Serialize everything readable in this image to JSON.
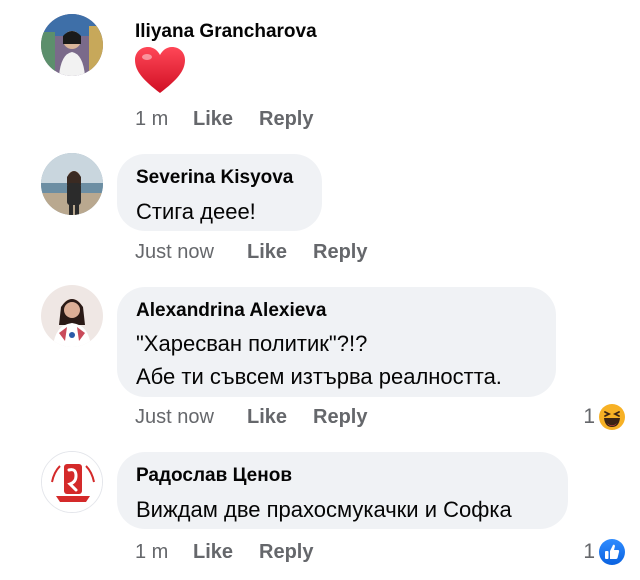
{
  "comments": [
    {
      "author": "Iliyana Grancharova",
      "text": "",
      "sticker": "heart-icon",
      "time": "1 m",
      "like_label": "Like",
      "reply_label": "Reply",
      "reaction": null
    },
    {
      "author": "Severina Kisyova",
      "text": "Стига деее!",
      "time": "Just now",
      "like_label": "Like",
      "reply_label": "Reply",
      "reaction": null
    },
    {
      "author": "Alexandrina Alexieva",
      "text": "\"Харесван политик\"?!?",
      "text_line2": "Абе ти съвсем изтърва реалността.",
      "time": "Just now",
      "like_label": "Like",
      "reply_label": "Reply",
      "reaction": {
        "count": "1",
        "icon": "laugh-haha-icon"
      }
    },
    {
      "author": "Радослав Ценов",
      "text": "Виждам две прахосмукачки и Софка",
      "time": "1 m",
      "like_label": "Like",
      "reply_label": "Reply",
      "reaction": {
        "count": "1",
        "icon": "like-thumbs-up-icon"
      }
    }
  ],
  "colors": {
    "bubble": "#f0f2f5",
    "meta_text": "#65676b",
    "like_blue": "#1877f2",
    "heart_red": "#e0162b",
    "haha_yellow": "#f7b125"
  }
}
